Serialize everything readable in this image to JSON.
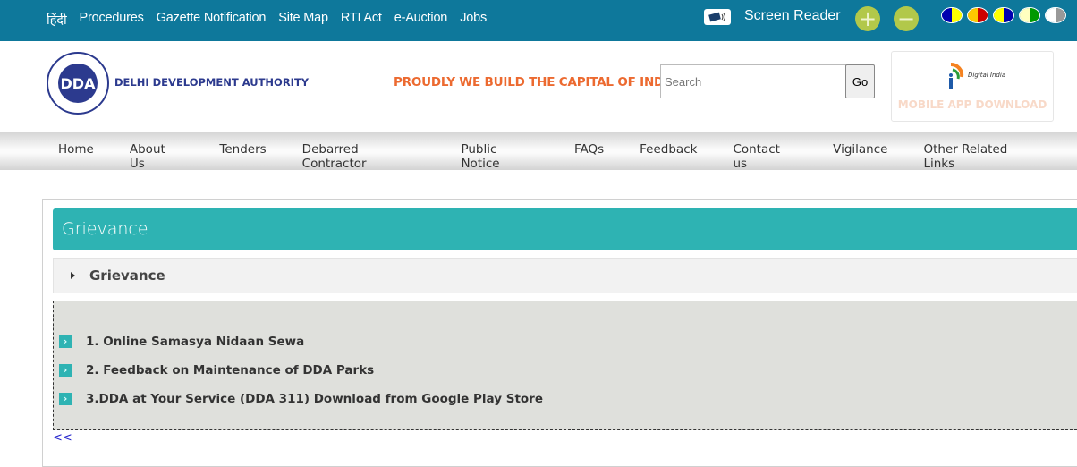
{
  "topbar": {
    "links": [
      "हिंदी",
      "Procedures",
      "Gazette Notification",
      "Site Map",
      "RTI Act",
      "e-Auction",
      "Jobs"
    ],
    "screen_reader_label": "Screen Reader",
    "zoom_in": "+",
    "zoom_out": "−",
    "theme_colors": [
      [
        "#0000b0",
        "#ffff00"
      ],
      [
        "#ffc800",
        "#cc0000"
      ],
      [
        "#ffff00",
        "#0000b0"
      ],
      [
        "#ffffc0",
        "#009900"
      ],
      [
        "#ffffff",
        "#999999"
      ]
    ]
  },
  "header": {
    "org_name": "DELHI DEVELOPMENT AUTHORITY",
    "logo_text": "DDA",
    "tagline": "PROUDLY WE BUILD THE CAPITAL OF INDIA",
    "search_placeholder": "Search",
    "search_button": "Go",
    "app_brand": "Digital India",
    "app_label": "MOBILE APP DOWNLOAD"
  },
  "nav": {
    "items": [
      "Home",
      "About Us",
      "Tenders",
      "Debarred Contractor",
      "Public Notice",
      "FAQs",
      "Feedback",
      "Contact us",
      "Vigilance",
      "Other Related Links"
    ]
  },
  "main": {
    "title": "Grievance",
    "accordion_label": "Grievance",
    "items": [
      "1. Online Samasya Nidaan Sewa",
      "2. Feedback on Maintenance of DDA Parks",
      "3.DDA at Your Service (DDA 311) Download from Google Play Store"
    ],
    "back_link": "<<"
  }
}
